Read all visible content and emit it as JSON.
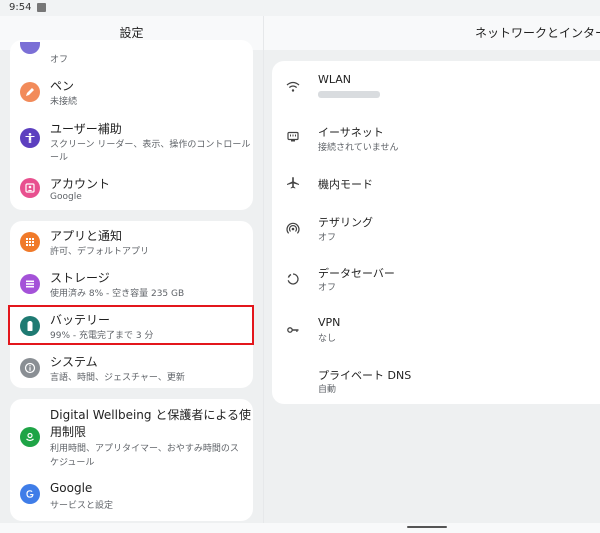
{
  "status": {
    "time": "9:54"
  },
  "left_title": "設定",
  "right_title": "ネットワークとインター",
  "top_partial": {
    "subtitle": "オフ",
    "color": "#7b6fd6"
  },
  "group1": [
    {
      "title": "ペン",
      "subtitle": "未接続",
      "icon": "pen-icon",
      "color": "#f28b5a"
    },
    {
      "title": "ユーザー補助",
      "subtitle": "スクリーン リーダー、表示、操作のコントロール",
      "subtitle2": "ール",
      "icon": "accessibility-icon",
      "color": "#5c3fbf"
    },
    {
      "title": "アカウント",
      "subtitle": "Google",
      "icon": "account-icon",
      "color": "#e8508f"
    }
  ],
  "group2": [
    {
      "title": "アプリと通知",
      "subtitle": "許可、デフォルトアプリ",
      "icon": "apps-icon",
      "color": "#f07a2a"
    },
    {
      "title": "ストレージ",
      "subtitle": "使用済み 8% - 空き容量 235 GB",
      "icon": "storage-icon",
      "color": "#a452d8"
    },
    {
      "title": "バッテリー",
      "subtitle": "99% - 充電完了まで 3 分",
      "icon": "battery-icon",
      "color": "#1e7a72"
    },
    {
      "title": "システム",
      "subtitle": "言語、時間、ジェスチャー、更新",
      "icon": "info-icon",
      "color": "#8a8f94"
    }
  ],
  "group3": [
    {
      "title_line1": "Digital Wellbeing と保護者による使",
      "title_line2": "用制限",
      "subtitle_line1": "利用時間、アプリタイマー、おやすみ時間のス",
      "subtitle_line2": "ケジュール",
      "icon": "wellbeing-icon",
      "color": "#1ea446"
    },
    {
      "title": "Google",
      "subtitle": "サービスと設定",
      "icon": "google-icon",
      "color": "#3f7de8"
    }
  ],
  "network": [
    {
      "title": "WLAN",
      "subtitle": "",
      "icon": "wifi-icon"
    },
    {
      "title": "イーサネット",
      "subtitle": "接続されていません",
      "icon": "ethernet-icon"
    },
    {
      "title": "機内モード",
      "subtitle": "",
      "icon": "airplane-icon"
    },
    {
      "title": "テザリング",
      "subtitle": "オフ",
      "icon": "hotspot-icon"
    },
    {
      "title": "データセーバー",
      "subtitle": "オフ",
      "icon": "data-saver-icon"
    },
    {
      "title": "VPN",
      "subtitle": "なし",
      "icon": "vpn-icon"
    },
    {
      "title": "プライベート DNS",
      "subtitle": "自動",
      "icon": ""
    }
  ]
}
